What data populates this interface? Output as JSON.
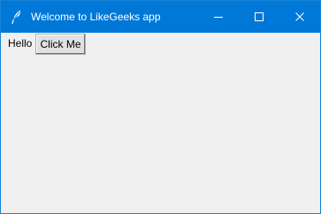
{
  "window": {
    "title": "Welcome to LikeGeeks app",
    "icon": "feather-icon",
    "accent_color": "#0078d7",
    "controls": {
      "minimize_icon": "minimize-icon",
      "maximize_icon": "maximize-icon",
      "close_icon": "close-icon"
    }
  },
  "content": {
    "label": "Hello",
    "button_label": "Click Me"
  }
}
